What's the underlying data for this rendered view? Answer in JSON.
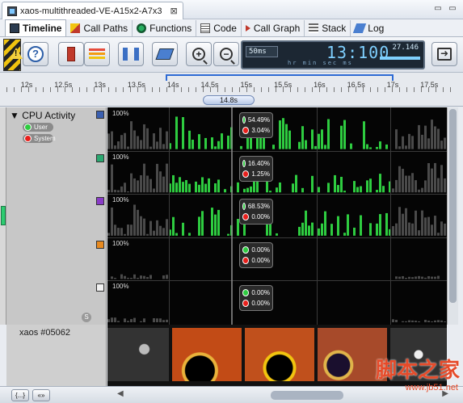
{
  "window": {
    "doc_tab_title": "xaos-multithreaded-VE-A15x2-A7x3",
    "close_glyph": "⊠",
    "controls": [
      "▭",
      "▭"
    ]
  },
  "tabs": [
    {
      "label": "Timeline",
      "icon": "timeline-icon",
      "active": true
    },
    {
      "label": "Call Paths",
      "icon": "call-paths-icon"
    },
    {
      "label": "Functions",
      "icon": "functions-icon"
    },
    {
      "label": "Code",
      "icon": "code-icon"
    },
    {
      "label": "Call Graph",
      "icon": "call-graph-icon"
    },
    {
      "label": "Stack",
      "icon": "stack-icon"
    },
    {
      "label": "Log",
      "icon": "log-icon"
    }
  ],
  "lcd": {
    "interval": "50ms",
    "time": "13:100",
    "right_value": "27.146",
    "units": "hr min sec ms"
  },
  "ruler": {
    "labels": [
      "12s",
      "12.5s",
      "13s",
      "13.5s",
      "14s",
      "14.5s",
      "15s",
      "15.5s",
      "16s",
      "16.5s",
      "17s",
      "17.5s"
    ],
    "window_label": "14.8s"
  },
  "left_panel": {
    "title": "CPU Activity",
    "expander": "▼",
    "legend": [
      {
        "label": "User",
        "color": "#2ecc40"
      },
      {
        "label": "System",
        "color": "#e8201c"
      }
    ],
    "scroll_badge": "S"
  },
  "cores": [
    {
      "swatch": "#3a5fb0",
      "label": "100%",
      "user": "54.49%",
      "system": "3.04%"
    },
    {
      "swatch": "#2aa870",
      "label": "100%",
      "user": "16.40%",
      "system": "1.25%"
    },
    {
      "swatch": "#8a3cc8",
      "label": "100%",
      "user": "68.53%",
      "system": "0.00%"
    },
    {
      "swatch": "#e88a20",
      "label": "100%",
      "user": "0.00%",
      "system": "0.00%"
    },
    {
      "swatch": "#f2f2f2",
      "label": "100%",
      "user": "0.00%",
      "system": "0.00%"
    }
  ],
  "thumbnails": {
    "label": "xaos #05062"
  },
  "bottom": {
    "btn1": "{...}",
    "btn2": "«»"
  },
  "watermark": {
    "text": "脚本之家",
    "url": "www.jb51.net"
  },
  "colors": {
    "user": "#2ecc40",
    "system": "#e8201c",
    "accent": "#2d6ad4"
  }
}
